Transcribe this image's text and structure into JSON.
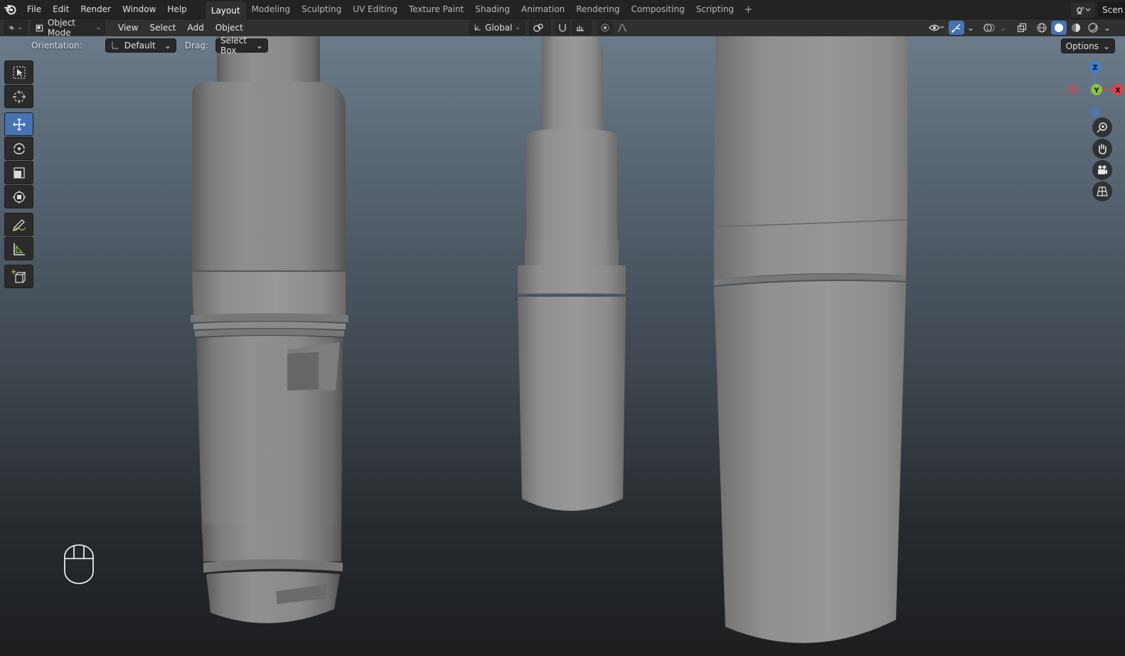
{
  "topbar": {
    "menus": [
      "File",
      "Edit",
      "Render",
      "Window",
      "Help"
    ],
    "workspaces": [
      "Layout",
      "Modeling",
      "Sculpting",
      "UV Editing",
      "Texture Paint",
      "Shading",
      "Animation",
      "Rendering",
      "Compositing",
      "Scripting"
    ],
    "active_workspace": "Layout",
    "add_tab": "+",
    "scene_name": "Scen"
  },
  "header": {
    "mode": "Object Mode",
    "menus": [
      "View",
      "Select",
      "Add",
      "Object"
    ],
    "transform_orientation": "Global"
  },
  "tool_settings": {
    "orientation_label": "Orientation:",
    "orientation_value": "Default",
    "drag_label": "Drag:",
    "drag_value": "Select Box",
    "options_label": "Options"
  },
  "toolbar": {
    "tools": [
      "select-box",
      "cursor",
      "move",
      "rotate",
      "scale",
      "transform",
      "annotate",
      "measure",
      "add-cube"
    ],
    "active_tool": "move"
  },
  "gizmo": {
    "axis_z": "Z",
    "axis_y": "Y",
    "axis_x": "X",
    "colors": {
      "x": "#e0424a",
      "y": "#8bc53f",
      "z": "#3f7fd6"
    }
  },
  "colors": {
    "accent": "#4772b3",
    "viewport_top": "#6b7b8a",
    "viewport_bottom": "#1c1e20"
  }
}
